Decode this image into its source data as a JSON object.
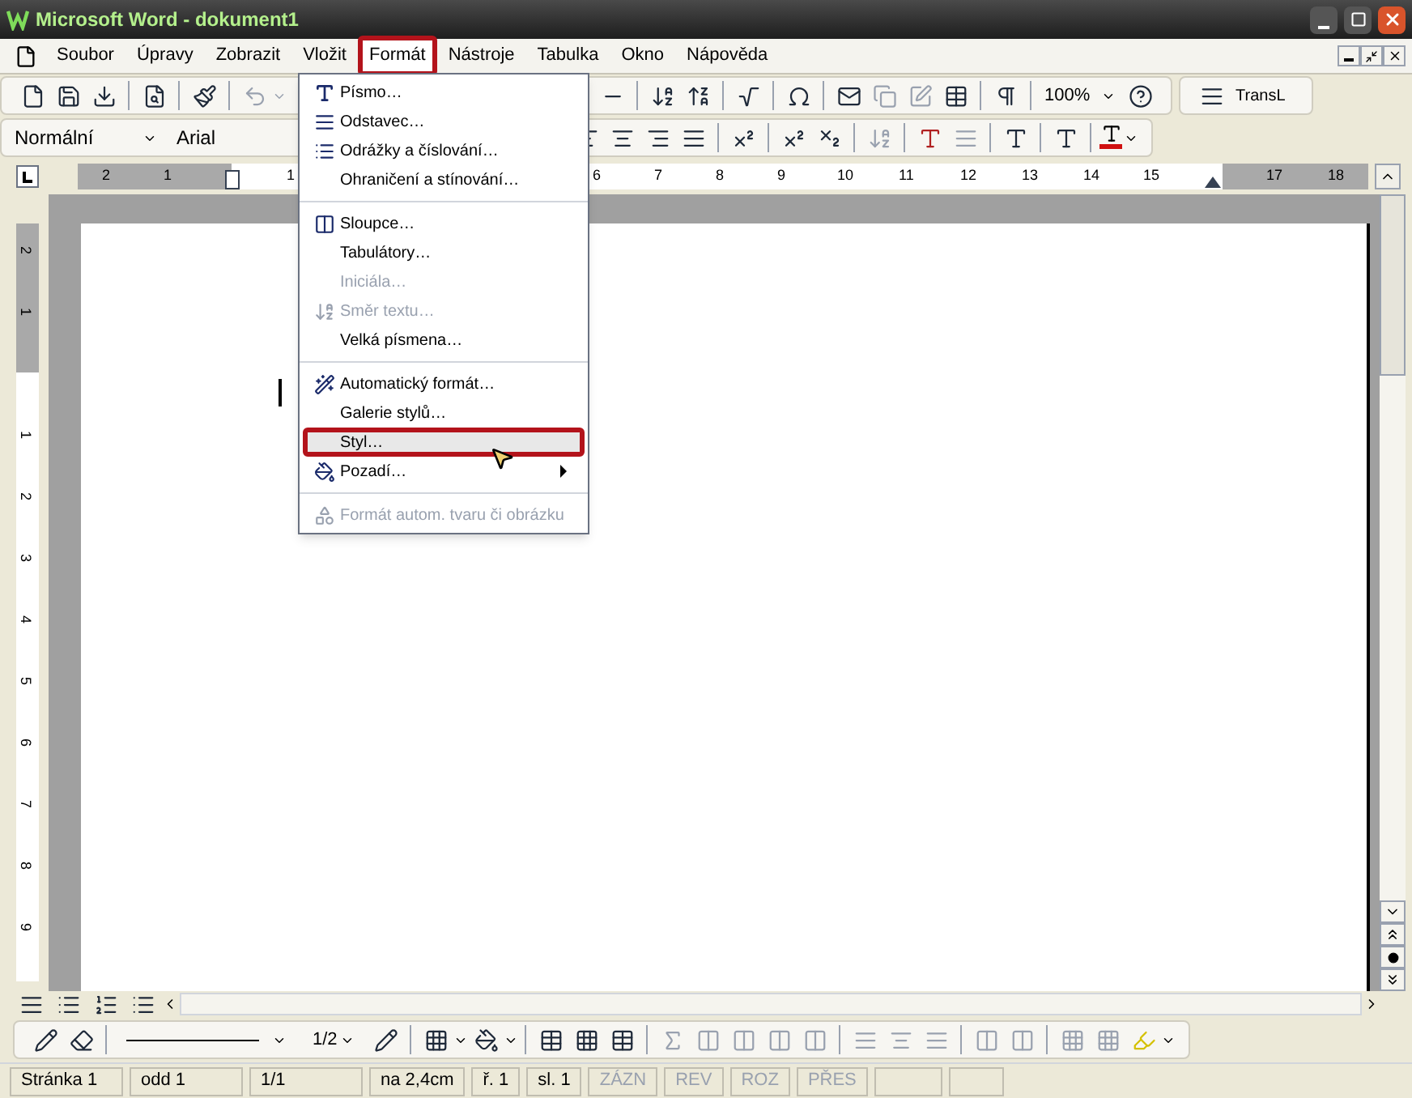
{
  "window": {
    "title": "Microsoft Word - dokument1"
  },
  "menu_bar": [
    {
      "label": "Soubor",
      "selected": false
    },
    {
      "label": "Úpravy",
      "selected": false
    },
    {
      "label": "Zobrazit",
      "selected": false
    },
    {
      "label": "Vložit",
      "selected": false
    },
    {
      "label": "Formát",
      "selected": true
    },
    {
      "label": "Nástroje",
      "selected": false
    },
    {
      "label": "Tabulka",
      "selected": false
    },
    {
      "label": "Okno",
      "selected": false
    },
    {
      "label": "Nápověda",
      "selected": false
    }
  ],
  "format_menu": {
    "groups": [
      [
        {
          "label": "Písmo…",
          "disabled": false,
          "selected": false,
          "submenu": false
        },
        {
          "label": "Odstavec…",
          "disabled": false,
          "selected": false,
          "submenu": false
        },
        {
          "label": "Odrážky a číslování…",
          "disabled": false,
          "selected": false,
          "submenu": false
        },
        {
          "label": "Ohraničení a stínování…",
          "disabled": false,
          "selected": false,
          "submenu": false
        }
      ],
      [
        {
          "label": "Sloupce…",
          "disabled": false,
          "selected": false,
          "submenu": false
        },
        {
          "label": "Tabulátory…",
          "disabled": false,
          "selected": false,
          "submenu": false
        },
        {
          "label": "Iniciála…",
          "disabled": true,
          "selected": false,
          "submenu": false
        },
        {
          "label": "Směr textu…",
          "disabled": true,
          "selected": false,
          "submenu": false
        },
        {
          "label": "Velká písmena…",
          "disabled": false,
          "selected": false,
          "submenu": false
        }
      ],
      [
        {
          "label": "Automatický formát…",
          "disabled": false,
          "selected": false,
          "submenu": false
        },
        {
          "label": "Galerie stylů…",
          "disabled": false,
          "selected": false,
          "submenu": false
        },
        {
          "label": "Styl…",
          "disabled": false,
          "selected": true,
          "submenu": false
        },
        {
          "label": "Pozadí…",
          "disabled": false,
          "selected": false,
          "submenu": true
        }
      ],
      [
        {
          "label": "Formát autom. tvaru či obrázku",
          "disabled": true,
          "selected": false,
          "submenu": false
        }
      ]
    ]
  },
  "standard_toolbar": {
    "zoom": "100%",
    "trans_button": "TransL"
  },
  "formatting_toolbar": {
    "style": "Normální",
    "font": "Arial"
  },
  "horizontal_ruler": [
    {
      "label": "2"
    },
    {
      "label": "1"
    },
    {
      "label": "1"
    },
    {
      "label": "6"
    },
    {
      "label": "7"
    },
    {
      "label": "8"
    },
    {
      "label": "9"
    },
    {
      "label": "10"
    },
    {
      "label": "11"
    },
    {
      "label": "12"
    },
    {
      "label": "13"
    },
    {
      "label": "14"
    },
    {
      "label": "15"
    },
    {
      "label": "17"
    },
    {
      "label": "18"
    }
  ],
  "vertical_ruler": [
    {
      "label": "2"
    },
    {
      "label": "1"
    },
    {
      "label": "1"
    },
    {
      "label": "2"
    },
    {
      "label": "3"
    },
    {
      "label": "4"
    },
    {
      "label": "5"
    },
    {
      "label": "6"
    },
    {
      "label": "7"
    },
    {
      "label": "8"
    },
    {
      "label": "9"
    }
  ],
  "drawing_toolbar": {
    "line_weight": "1/2"
  },
  "status_bar": [
    {
      "label": "Stránka 1",
      "disabled": false
    },
    {
      "label": "odd 1",
      "disabled": false
    },
    {
      "label": "1/1",
      "disabled": false
    },
    {
      "label": "na 2,4cm",
      "disabled": false
    },
    {
      "label": "ř. 1",
      "disabled": false
    },
    {
      "label": "sl. 1",
      "disabled": false
    },
    {
      "label": "ZÁZN",
      "disabled": true
    },
    {
      "label": "REV",
      "disabled": true
    },
    {
      "label": "ROZ",
      "disabled": true
    },
    {
      "label": "PŘES",
      "disabled": true
    }
  ]
}
